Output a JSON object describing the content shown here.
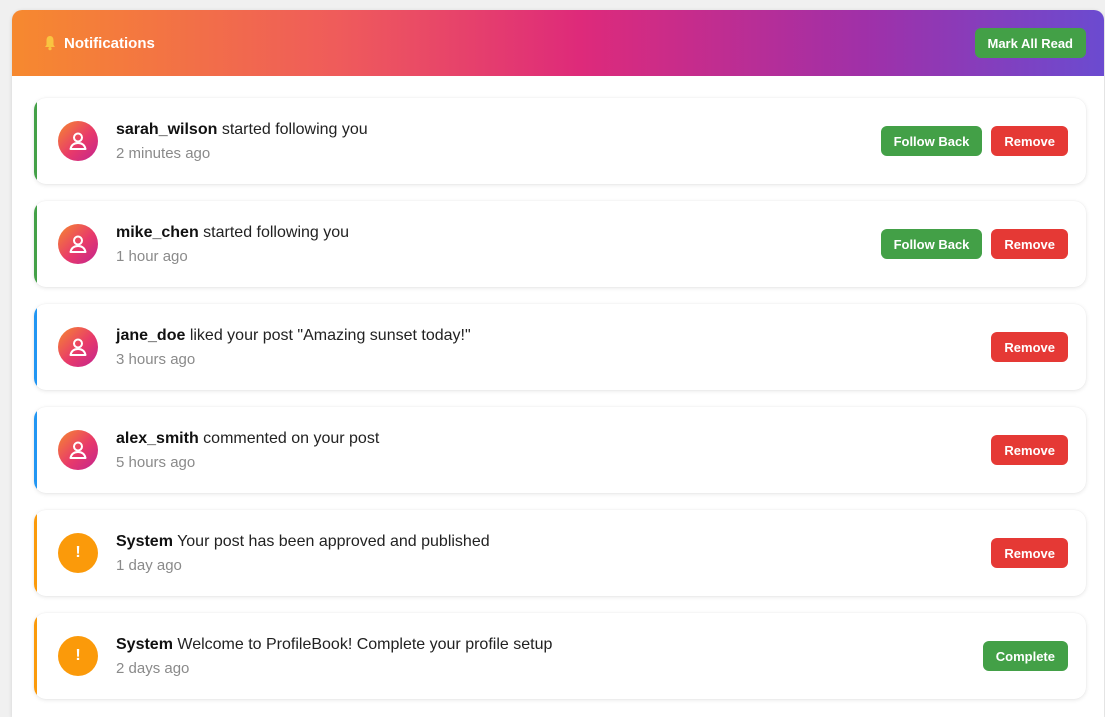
{
  "header": {
    "title": "Notifications",
    "mark_all_label": "Mark All Read"
  },
  "notifications": [
    {
      "actor": "sarah_wilson",
      "text": "started following you",
      "time": "2 minutes ago",
      "accent": "#43a047",
      "avatar": "user-icon",
      "actions": [
        "Follow Back",
        "Remove"
      ]
    },
    {
      "actor": "mike_chen",
      "text": "started following you",
      "time": "1 hour ago",
      "accent": "#43a047",
      "avatar": "user-icon",
      "actions": [
        "Follow Back",
        "Remove"
      ]
    },
    {
      "actor": "jane_doe",
      "text": "liked your post \"Amazing sunset today!\"",
      "time": "3 hours ago",
      "accent": "#2196f3",
      "avatar": "user-icon",
      "actions": [
        "Remove"
      ]
    },
    {
      "actor": "alex_smith",
      "text": "commented on your post",
      "time": "5 hours ago",
      "accent": "#2196f3",
      "avatar": "user-icon",
      "actions": [
        "Remove"
      ]
    },
    {
      "actor": "System",
      "text": "Your post has been approved and published",
      "time": "1 day ago",
      "accent": "#fb9a0a",
      "avatar": "alert-icon",
      "avatar_glyph": "!",
      "actions": [
        "Remove"
      ]
    },
    {
      "actor": "System",
      "text": "Welcome to ProfileBook! Complete your profile setup",
      "time": "2 days ago",
      "accent": "#fb9a0a",
      "avatar": "alert-icon",
      "avatar_glyph": "!",
      "actions": [
        "Complete"
      ]
    }
  ],
  "colors": {
    "green": "#43a047",
    "red": "#e53935",
    "orange": "#fb9a0a",
    "blue": "#2196f3"
  }
}
